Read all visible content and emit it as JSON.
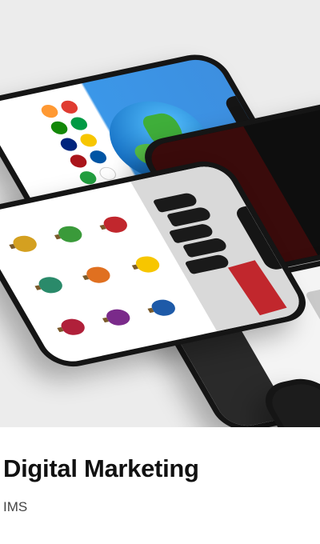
{
  "card": {
    "title": "Digital Marketing",
    "subtitle": "IMS"
  },
  "colors": {
    "hero_background": "#ececec",
    "phone_body": "#151515",
    "globe_sky": "#3b97e8",
    "accent_red": "#c1272d"
  }
}
